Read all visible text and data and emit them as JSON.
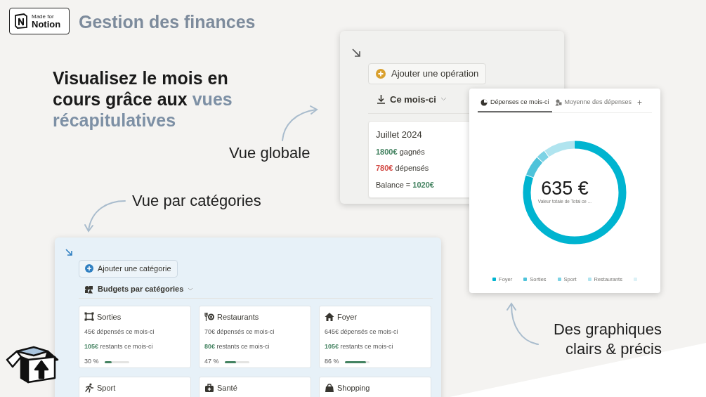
{
  "badge": {
    "small": "Made for",
    "big": "Notion"
  },
  "title": "Gestion des finances",
  "headline": "Visualisez le mois en cours grâce aux **vues récapitulatives**",
  "annotations": [
    {
      "text": "Vue globale"
    },
    {
      "text": "Vue par catégories"
    },
    {
      "text": "Des graphiques clairs & précis"
    }
  ],
  "overview": {
    "add_button": "Ajouter une opération",
    "view": "Ce mois-ci",
    "card": {
      "title": "Juillet 2024",
      "lines": [
        {
          "text": "**1800€** gagnés",
          "color": "#448361"
        },
        {
          "text": "**780€** dépensés",
          "color": "#d44c47"
        },
        {
          "text": "Balance = **1020€**",
          "color": "#448361"
        }
      ]
    }
  },
  "chart_panel": {
    "tabs": [
      {
        "label": "Dépenses ce mois-ci",
        "kind": "pie",
        "selected": true
      },
      {
        "label": "Moyenne des dépenses",
        "kind": "shapes",
        "selected": false
      }
    ],
    "add_tab": "+",
    "total": "635 €",
    "caption": "Valeur totale de Total ce ...",
    "legend": [
      {
        "label": "Foyer",
        "color": "#00b4d0"
      },
      {
        "label": "Sorties",
        "color": "#4fc3da"
      },
      {
        "label": "Sport",
        "color": "#7dd3e5"
      },
      {
        "label": "Restaurants",
        "color": "#b0e4ef"
      },
      {
        "color": "#dcf1f6"
      }
    ]
  },
  "categories": {
    "add_button": "Ajouter une catégorie",
    "view": "Budgets par catégories",
    "cards": [
      {
        "kind": "frame",
        "title": "Sorties",
        "spent": "45€ dépensés ce mois-ci",
        "remaining": "**105€** restants ce mois-ci",
        "percent": "30 %",
        "level": 0.3
      },
      {
        "kind": "dining",
        "title": "Restaurants",
        "spent": "70€ dépensés ce mois-ci",
        "remaining": "**80€** restants ce mois-ci",
        "percent": "47 %",
        "level": 0.47
      },
      {
        "kind": "house",
        "title": "Foyer",
        "spent": "645€ dépensés ce mois-ci",
        "remaining": "**105€** restants ce mois-ci",
        "percent": "86 %",
        "level": 0.86
      },
      {
        "kind": "runner",
        "title": "Sport"
      },
      {
        "kind": "medkit",
        "title": "Santé"
      },
      {
        "kind": "bag",
        "title": "Shopping"
      }
    ]
  }
}
